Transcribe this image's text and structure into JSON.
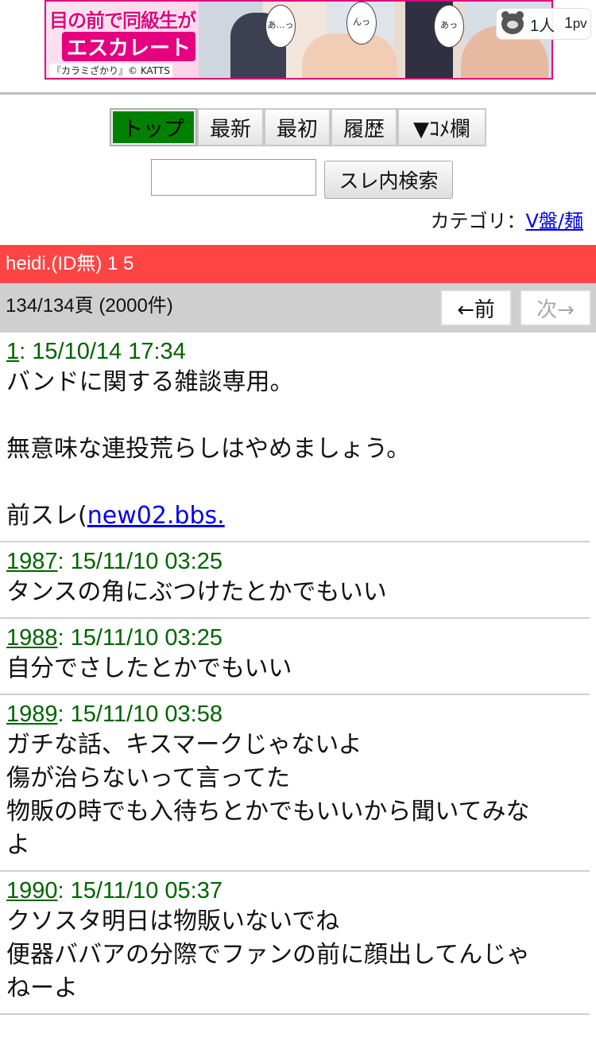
{
  "banner": {
    "ad_line1": "目の前で同級生が",
    "ad_line2": "エスカレート",
    "ad_credit": "『カラミざかり』© KATTS",
    "bubble_1": "あ…っ",
    "bubble_2": "んっ",
    "bubble_3": "あっ",
    "counter_people": "1人",
    "counter_pv_num": "1",
    "counter_pv_unit": "pv"
  },
  "nav": {
    "top": "トップ",
    "latest": "最新",
    "first": "最初",
    "history": "履歴",
    "comment": "▼ｺﾒ欄"
  },
  "search": {
    "value": "",
    "button": "スレ内検索"
  },
  "category": {
    "label": "カテゴリ：",
    "link": "V盤/麺"
  },
  "thread": {
    "title": "heidi.(ID無) 1 5",
    "page_info": "134/134頁 (2000件)",
    "prev": "←前",
    "next": "次→"
  },
  "posts": [
    {
      "num": "1",
      "date": ": 15/10/14 17:34",
      "body": "バンドに関する雑談専用。\n\n無意味な連投荒らしはやめましょう。\n\n前スレ(",
      "link": "new02.bbs."
    },
    {
      "num": "1987",
      "date": ": 15/11/10 03:25",
      "body": "タンスの角にぶつけたとかでもいい"
    },
    {
      "num": "1988",
      "date": ": 15/11/10 03:25",
      "body": "自分でさしたとかでもいい"
    },
    {
      "num": "1989",
      "date": ": 15/11/10 03:58",
      "body": "ガチな話、キスマークじゃないよ\n傷が治らないって言ってた\n物販の時でも入待ちとかでもいいから聞いてみな\nよ"
    },
    {
      "num": "1990",
      "date": ": 15/11/10 05:37",
      "body": "クソスタ明日は物販いないでね\n便器ババアの分際でファンの前に顔出してんじゃ\nねーよ"
    }
  ]
}
